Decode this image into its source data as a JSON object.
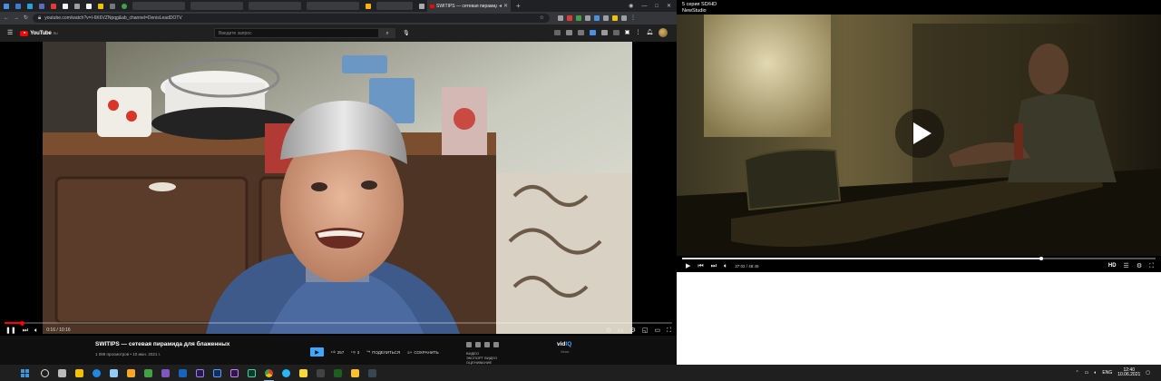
{
  "browser": {
    "active_tab_title": "SWITIPS — сетевая пирамид",
    "address": "youtube.com/watch?v=I-6K6VZNpqg&ab_channel=DenisLeadDOTV"
  },
  "youtube": {
    "logo_text": "YouTube",
    "logo_suffix": "RU",
    "search_placeholder": "Введите запрос",
    "player": {
      "time_current": "0:16",
      "time_total": "10:16",
      "progress": 0.026
    },
    "video": {
      "title": "SWITIPS — сетевая пирамида для блаженных",
      "meta": "1 089 просмотров • 10 июн. 2021 г.",
      "likes": "257",
      "dislikes": "3",
      "share_label": "ПОДЕЛИТЬСЯ",
      "save_label": "СОХРАНИТЬ"
    },
    "vidiq": {
      "brand_a": "vid",
      "brand_b": "IQ",
      "sub": "Vision",
      "lines": [
        "ВИДЕО",
        "ЭКСПОРТ ВИДЕО",
        "ОЦЕНИВАНИЕ"
      ]
    }
  },
  "right_player": {
    "title_line1": "5 серия SD/HD",
    "title_line2": "NewStudio",
    "time_current": "37:02",
    "time_total": "48:45",
    "progress": 0.76,
    "hd_label": "HD"
  },
  "taskbar": {
    "language": "ENG",
    "time": "12:40",
    "date": "10.06.2021"
  },
  "colors": {
    "yt_red": "#ff0000",
    "taskbar": "#1f1f1f",
    "windows_blue": "#3a96dd"
  }
}
